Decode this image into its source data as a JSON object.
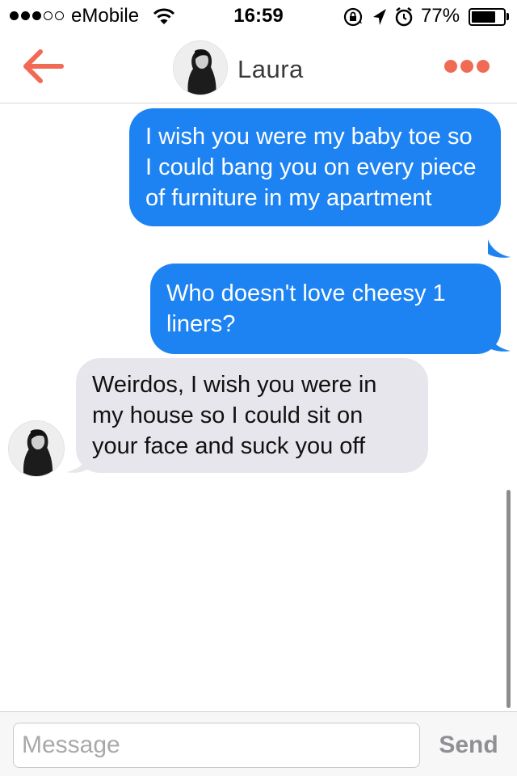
{
  "status_bar": {
    "carrier": "eMobile",
    "time": "16:59",
    "battery_percent": "77%",
    "battery_level": 0.77,
    "signal_bars_filled": 3,
    "signal_bars_total": 5
  },
  "nav": {
    "contact_name": "Laura",
    "back_icon": "back-arrow-icon",
    "more_icon": "more-dots-icon",
    "accent_color": "#f16a55"
  },
  "messages": [
    {
      "direction": "outgoing",
      "text": "I wish you were my baby toe so I could bang you on every piece of furniture in my apartment"
    },
    {
      "direction": "outgoing",
      "text": "Who doesn't love cheesy 1 liners?"
    },
    {
      "direction": "incoming",
      "text": "Weirdos, I wish you were in my house so I could sit on your face and suck you off"
    }
  ],
  "composer": {
    "placeholder": "Message",
    "value": "",
    "send_label": "Send"
  },
  "colors": {
    "outgoing_bubble": "#1e83f2",
    "incoming_bubble": "#e6e6ec"
  }
}
